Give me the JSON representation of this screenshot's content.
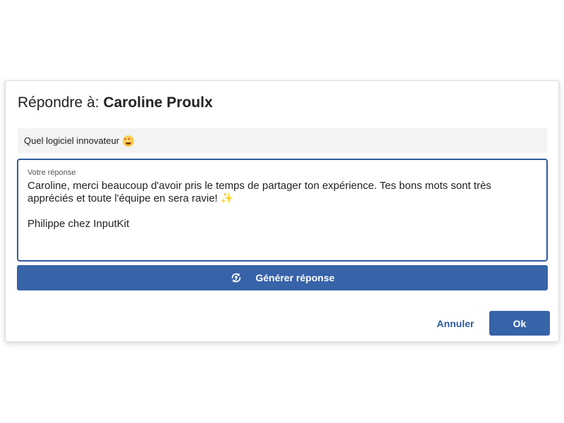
{
  "dialog": {
    "title_prefix": "Répondre à:",
    "title_name": "Caroline Proulx",
    "review_text": "Quel logiciel innovateur",
    "review_emoji": "star-struck-emoji",
    "reply": {
      "label": "Votre réponse",
      "line1": "Caroline, merci beaucoup d'avoir pris le temps de partager ton expérience. Tes bons mots sont très",
      "line2": "appréciés et toute l'équipe en sera ravie!",
      "sparkle": "✨",
      "signature": "Philippe chez InputKit"
    },
    "generate_label": "Générer réponse",
    "generate_icon": "ai-generate-icon",
    "cancel_label": "Annuler",
    "ok_label": "Ok"
  },
  "colors": {
    "primary": "#3763a8",
    "field_border": "#2f5a9e",
    "review_background": "#f3f3f3",
    "text": "#222222"
  }
}
